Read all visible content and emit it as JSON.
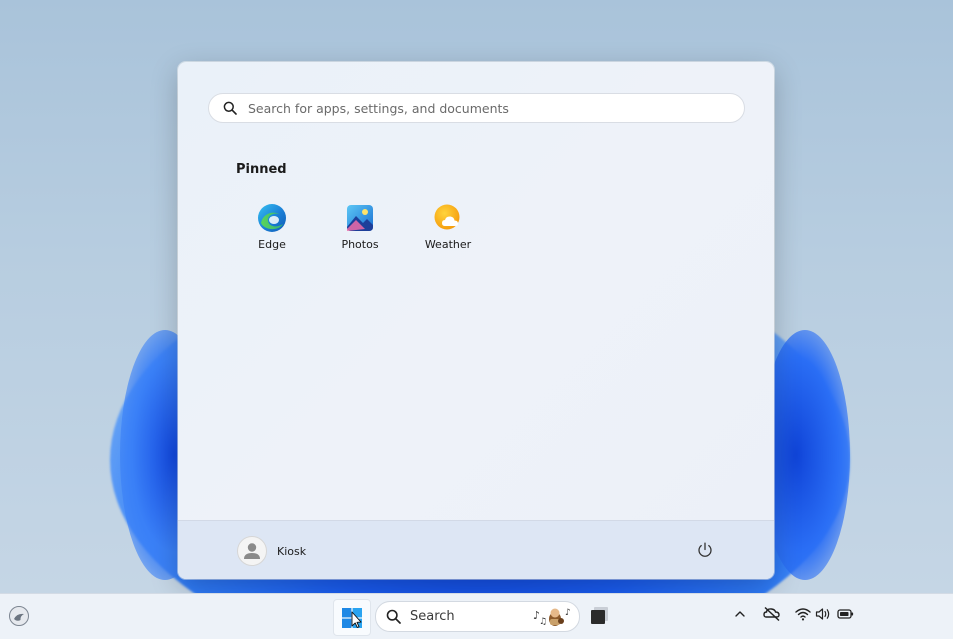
{
  "start_menu": {
    "search": {
      "placeholder": "Search for apps, settings, and documents"
    },
    "pinned_heading": "Pinned",
    "pinned_apps": [
      {
        "label": "Edge",
        "icon": "edge-icon"
      },
      {
        "label": "Photos",
        "icon": "photos-icon"
      },
      {
        "label": "Weather",
        "icon": "weather-icon"
      }
    ],
    "footer": {
      "user_name": "Kiosk",
      "avatar_icon": "user-avatar-icon",
      "power_icon": "power-icon"
    }
  },
  "taskbar": {
    "widgets_icon": "widgets-icon",
    "start_icon": "windows-logo-icon",
    "search_label": "Search",
    "search_highlight_icon": "search-highlight-icon",
    "taskview_icon": "task-view-icon",
    "tray_icons": [
      "chevron-up-icon",
      "meet-now-icon",
      "wifi-icon",
      "volume-icon",
      "battery-icon"
    ]
  },
  "colors": {
    "accent": "#0067c0",
    "menu_background": "#eef2f9",
    "footer_background": "#dde6f4",
    "taskbar_background": "#edf2f8"
  }
}
